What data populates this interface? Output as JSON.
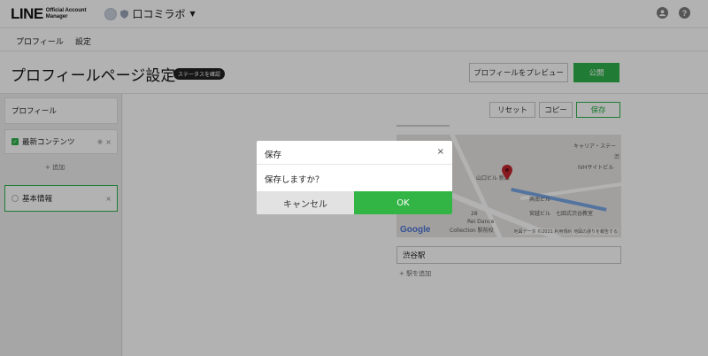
{
  "header": {
    "logo_main": "LINE",
    "logo_sub_1": "Official Account",
    "logo_sub_2": "Manager",
    "account_name": "口コミラボ",
    "icons": [
      "account-icon",
      "help-icon"
    ],
    "help_glyph": "?"
  },
  "tabs": [
    {
      "label": "プロフィール"
    },
    {
      "label": "設定"
    }
  ],
  "page": {
    "title": "プロフィールページ設定",
    "status_badge": "ステータスを確認",
    "preview_button": "プロフィールをプレビュー",
    "publish_button": "公開"
  },
  "sidebar": {
    "items": [
      {
        "label": "プロフィール"
      },
      {
        "label": "最新コンテンツ"
      },
      {
        "label": "基本情報"
      }
    ],
    "add_label": "+ 追加"
  },
  "toolbar": {
    "reset": "リセット",
    "copy": "コピー",
    "save": "保存"
  },
  "map": {
    "labels": [
      "キャリア・ステー",
      "渋",
      "IVHサイトビル",
      "山口ビル 新館",
      "興南ビル",
      "七田式渋谷教室",
      "宮越ビル",
      "28",
      "Rei Dance",
      "Collection 駅前校"
    ],
    "google": "Google",
    "credit": "地図データ ©2021   利用規約   地図の誤りを報告する"
  },
  "station": {
    "value": "渋谷駅",
    "add_label": "+ 駅を追加"
  },
  "dialog": {
    "title": "保存",
    "message": "保存しますか？",
    "cancel": "キャンセル",
    "ok": "OK",
    "close_glyph": "×"
  },
  "colors": {
    "accent": "#2fb24b",
    "overlay": "rgba(0,0,0,0.30)"
  }
}
